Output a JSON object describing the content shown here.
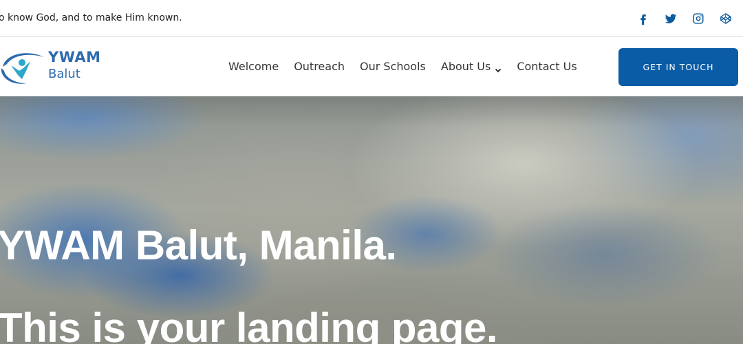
{
  "topbar": {
    "tagline": "o know God, and to make Him known.",
    "socials": [
      {
        "icon": "facebook-icon"
      },
      {
        "icon": "twitter-icon"
      },
      {
        "icon": "instagram-icon"
      },
      {
        "icon": "codepen-icon"
      }
    ]
  },
  "logo": {
    "title": "YWAM",
    "subtitle": "Balut"
  },
  "nav": {
    "items": [
      {
        "label": "Welcome"
      },
      {
        "label": "Outreach"
      },
      {
        "label": "Our Schools"
      },
      {
        "label": "About Us",
        "has_dropdown": true
      },
      {
        "label": "Contact Us"
      }
    ]
  },
  "cta": {
    "label": "GET IN TOUCH"
  },
  "hero": {
    "title": "YWAM Balut, Manila.",
    "subtitle": "This is your landing page."
  },
  "colors": {
    "brand_blue": "#0b5ca6",
    "logo_blue": "#2e6aad",
    "text_dark": "#333333"
  }
}
